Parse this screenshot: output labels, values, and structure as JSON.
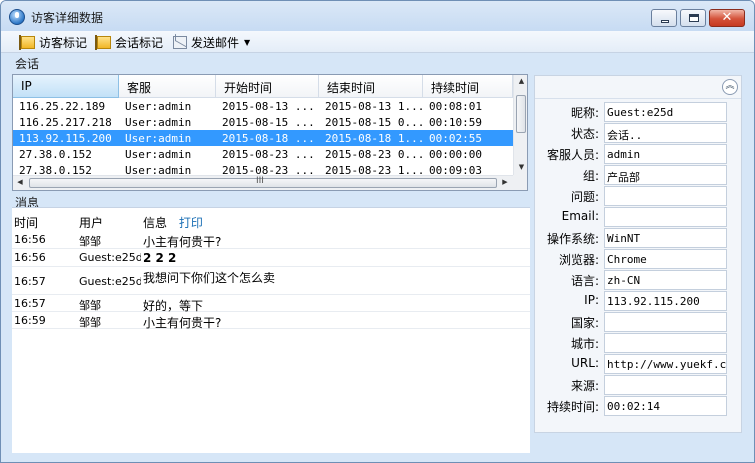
{
  "window": {
    "title": "访客详细数据"
  },
  "toolbar": {
    "visitor_mark": "访客标记",
    "session_mark": "会话标记",
    "send_mail": "发送邮件"
  },
  "sessions": {
    "label": "会话",
    "columns": [
      "IP",
      "客服",
      "开始时间",
      "结束时间",
      "持续时间"
    ],
    "rows": [
      [
        "116.25.22.189",
        "User:admin",
        "2015-08-13 ...",
        "2015-08-13 1...",
        "00:08:01"
      ],
      [
        "116.25.217.218",
        "User:admin",
        "2015-08-15 ...",
        "2015-08-15 0...",
        "00:10:59"
      ],
      [
        "113.92.115.200",
        "User:admin",
        "2015-08-18 ...",
        "2015-08-18 1...",
        "00:02:55"
      ],
      [
        "27.38.0.152",
        "User:admin",
        "2015-08-23 ...",
        "2015-08-23 0...",
        "00:00:00"
      ],
      [
        "27.38.0.152",
        "User:admin",
        "2015-08-23 ...",
        "2015-08-23 1...",
        "00:09:03"
      ]
    ],
    "selected_index": 2,
    "hscroll_grip": "III"
  },
  "messages": {
    "label": "消息",
    "col_time": "时间",
    "col_user": "用户",
    "col_info": "信息",
    "print_link": "打印",
    "rows": [
      {
        "time": "16:56",
        "user": "邹邹",
        "text": "小主有何贵干?"
      },
      {
        "time": "16:56",
        "user": "Guest:e25d",
        "text": "2 2 2"
      },
      {
        "time": "16:57",
        "user": "Guest:e25d",
        "text": "我想问下你们这个怎么卖"
      },
      {
        "time": "16:57",
        "user": "邹邹",
        "text": "好的，等下"
      },
      {
        "time": "16:59",
        "user": "邹邹",
        "text": "小主有何贵干?"
      }
    ]
  },
  "details": {
    "fields": [
      {
        "label": "昵称:",
        "value": "Guest:e25d"
      },
      {
        "label": "状态:",
        "value": "会话.."
      },
      {
        "label": "客服人员:",
        "value": "admin"
      },
      {
        "label": "组:",
        "value": "产品部"
      },
      {
        "label": "问题:",
        "value": ""
      },
      {
        "label": "Email:",
        "value": ""
      },
      {
        "label": "操作系统:",
        "value": "WinNT"
      },
      {
        "label": "浏览器:",
        "value": "Chrome"
      },
      {
        "label": "语言:",
        "value": "zh-CN"
      },
      {
        "label": "IP:",
        "value": "113.92.115.200"
      },
      {
        "label": "国家:",
        "value": ""
      },
      {
        "label": "城市:",
        "value": ""
      },
      {
        "label": "URL:",
        "value": "http://www.yuekf.com"
      },
      {
        "label": "来源:",
        "value": ""
      },
      {
        "label": "持续时间:",
        "value": "00:02:14"
      }
    ]
  }
}
